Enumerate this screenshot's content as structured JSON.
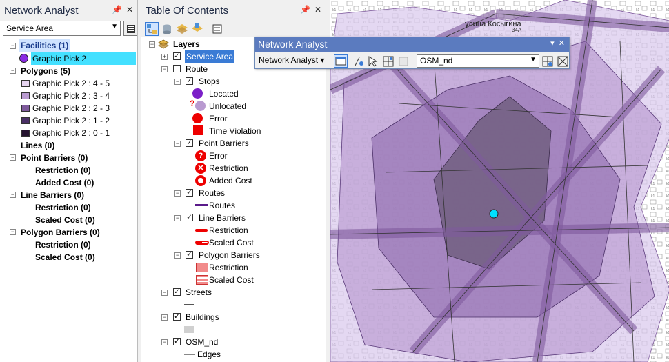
{
  "na_panel": {
    "title": "Network Analyst",
    "layer_select": "Service Area",
    "facilities": {
      "label": "Facilities (1)",
      "item": "Graphic Pick 2"
    },
    "polygons": {
      "label": "Polygons (5)",
      "items": [
        {
          "label": "Graphic Pick 2 : 4 - 5",
          "color": "#e6d4f0"
        },
        {
          "label": "Graphic Pick 2 : 3 - 4",
          "color": "#b99ad0"
        },
        {
          "label": "Graphic Pick 2 : 2 - 3",
          "color": "#7e5a9c"
        },
        {
          "label": "Graphic Pick 2 : 1 - 2",
          "color": "#4a2f66"
        },
        {
          "label": "Graphic Pick 2 : 0 - 1",
          "color": "#24122f"
        }
      ]
    },
    "lines": "Lines (0)",
    "point_barriers": {
      "label": "Point Barriers (0)",
      "items": [
        "Restriction (0)",
        "Added Cost (0)"
      ]
    },
    "line_barriers": {
      "label": "Line Barriers (0)",
      "items": [
        "Restriction (0)",
        "Scaled Cost (0)"
      ]
    },
    "polygon_barriers": {
      "label": "Polygon Barriers (0)",
      "items": [
        "Restriction (0)",
        "Scaled Cost (0)"
      ]
    }
  },
  "toc": {
    "title": "Table Of Contents",
    "layers": "Layers",
    "service_area": "Service Area",
    "route": "Route",
    "stops": "Stops",
    "stops_items": [
      "Located",
      "Unlocated",
      "Error",
      "Time Violation"
    ],
    "point_barriers": "Point Barriers",
    "point_barriers_items": [
      "Error",
      "Restriction",
      "Added Cost"
    ],
    "routes": "Routes",
    "routes_item": "Routes",
    "line_barriers": "Line Barriers",
    "line_barriers_items": [
      "Restriction",
      "Scaled Cost"
    ],
    "polygon_barriers": "Polygon Barriers",
    "polygon_barriers_items": [
      "Restriction",
      "Scaled Cost"
    ],
    "streets": "Streets",
    "buildings": "Buildings",
    "osm_nd": "OSM_nd",
    "edges": "Edges"
  },
  "na_toolbar": {
    "title": "Network Analyst",
    "menu": "Network Analyst ▾",
    "network": "OSM_nd"
  },
  "map": {
    "street_label": "улица Косыгина",
    "lot_label": "34А"
  },
  "colors": {
    "selection": "#44e0ff",
    "facility": "#00e0ff",
    "accent": "#5b7bbf"
  }
}
